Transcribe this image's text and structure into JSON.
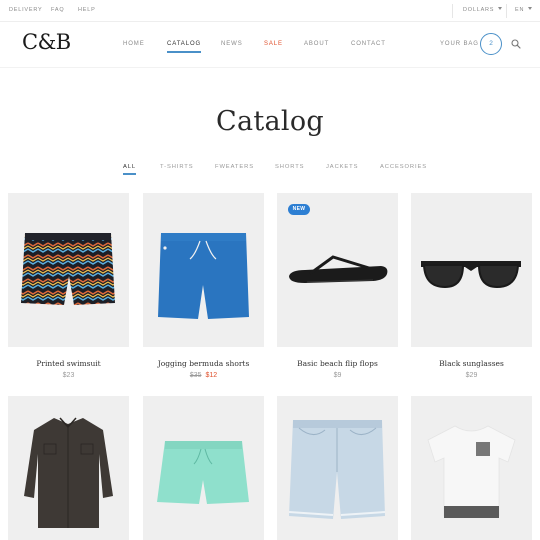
{
  "topbar": {
    "delivery": "DELIVERY",
    "faq": "FAQ",
    "help": "HELP",
    "currency": "DOLLARS",
    "language": "EN"
  },
  "header": {
    "logo": "C&B",
    "nav": [
      "HOME",
      "CATALOG",
      "NEWS",
      "SALE",
      "ABOUT",
      "CONTACT"
    ],
    "active_nav": "CATALOG",
    "bag_label": "YOUR BAG",
    "bag_count": "2"
  },
  "page": {
    "title": "Catalog"
  },
  "filters": {
    "tabs": [
      "ALL",
      "T-SHIRTS",
      "FWEATERS",
      "SHORTS",
      "JACKETS",
      "ACCESORIES"
    ],
    "active": "ALL"
  },
  "products": [
    {
      "name": "Printed swimsuit",
      "price": "$23",
      "image": "zigzag-swim-shorts"
    },
    {
      "name": "Jogging bermuda shorts",
      "old_price": "$35",
      "sale_price": "$12",
      "image": "blue-bermuda-shorts"
    },
    {
      "name": "Basic beach flip flops",
      "price": "$9",
      "badge": "NEW",
      "image": "black-flip-flop"
    },
    {
      "name": "Black sunglasses",
      "price": "$29",
      "image": "black-sunglasses"
    },
    {
      "image": "dark-button-shirt"
    },
    {
      "image": "mint-swim-shorts"
    },
    {
      "image": "denim-shorts"
    },
    {
      "image": "white-pocket-tshirt"
    }
  ],
  "colors": {
    "accent": "#4a90c8",
    "sale": "#e0512d",
    "badge": "#2d7fd3",
    "bermuda": "#2a75c0",
    "mint": "#8fe0cc",
    "denim": "#c7d8e6",
    "shirt": "#3e3935"
  }
}
